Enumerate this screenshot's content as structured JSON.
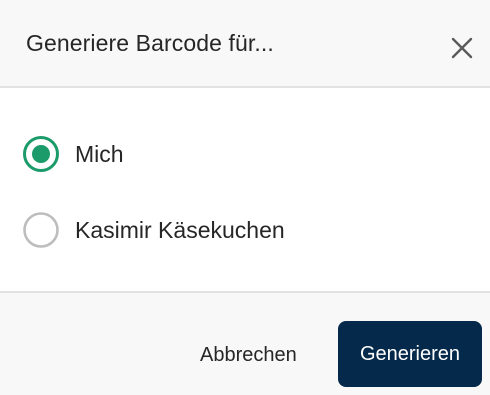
{
  "dialog": {
    "title": "Generiere Barcode für...",
    "close_icon": "close-icon"
  },
  "options": [
    {
      "label": "Mich",
      "selected": true
    },
    {
      "label": "Kasimir Käsekuchen",
      "selected": false
    }
  ],
  "footer": {
    "cancel_label": "Abbrechen",
    "primary_label": "Generieren"
  },
  "colors": {
    "accent": "#1b9b6a",
    "radio_unselected": "#bdbdbd",
    "primary_button": "#05294b",
    "header_bg": "#f8f8f8",
    "divider": "#e2e2e2",
    "text": "#262626"
  }
}
